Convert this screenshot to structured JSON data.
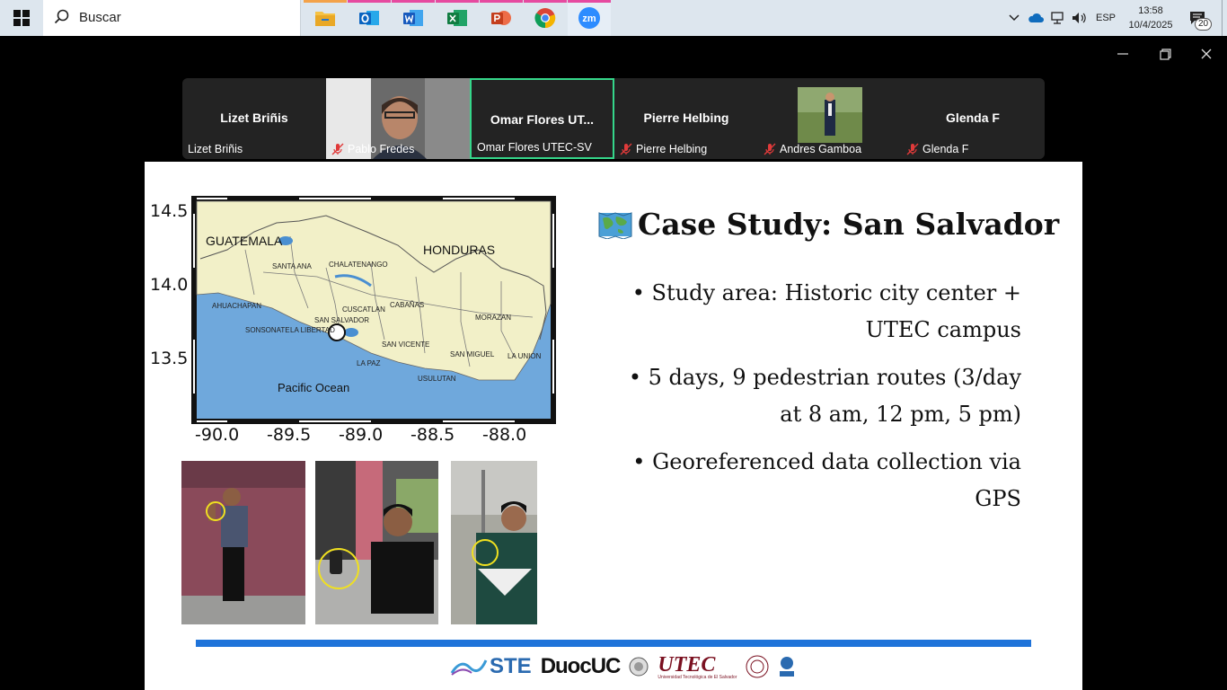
{
  "taskbar": {
    "search_placeholder": "Buscar",
    "apps": [
      {
        "name": "file-explorer",
        "bar": "#f3a24a"
      },
      {
        "name": "outlook",
        "bar": "#e64aa0"
      },
      {
        "name": "word",
        "bar": "#e64aa0"
      },
      {
        "name": "excel",
        "bar": "#e64aa0"
      },
      {
        "name": "powerpoint",
        "bar": "#e64aa0"
      },
      {
        "name": "chrome",
        "bar": "#e64aa0"
      },
      {
        "name": "zoom",
        "bar": "#e64aa0"
      }
    ],
    "language": "ESP",
    "time": "13:58",
    "date": "10/4/2025",
    "notifications": "20"
  },
  "participants": [
    {
      "center_name": "Lizet Briñis",
      "label": "Lizet Briñis",
      "muted": false,
      "video": false
    },
    {
      "center_name": "",
      "label": "Pablo Fredes",
      "muted": true,
      "video": true
    },
    {
      "center_name": "Omar Flores UT...",
      "label": "Omar Flores UTEC-SV",
      "muted": false,
      "video": false,
      "active": true
    },
    {
      "center_name": "Pierre Helbing",
      "label": "Pierre Helbing",
      "muted": true,
      "video": false
    },
    {
      "center_name": "",
      "label": "Andres Gamboa",
      "muted": true,
      "video": true
    },
    {
      "center_name": "Glenda F",
      "label": "Glenda F",
      "muted": true,
      "video": false
    }
  ],
  "slide": {
    "title": "Case Study: San Salvador",
    "bullets": [
      "Study area: Historic city center + UTEC campus",
      "5 days, 9 pedestrian routes (3/day at 8 am, 12 pm, 5 pm)",
      "Georeferenced data collection via GPS"
    ],
    "map": {
      "y_ticks": [
        "14.5",
        "14.0",
        "13.5"
      ],
      "x_ticks": [
        "-90.0",
        "-89.5",
        "-89.0",
        "-88.5",
        "-88.0"
      ],
      "countries": [
        "GUATEMALA",
        "HONDURAS"
      ],
      "ocean": "Pacific Ocean",
      "departments": [
        "SANTA ANA",
        "CHALATENANGO",
        "AHUACHAPAN",
        "CUSCATLAN",
        "CABAÑAS",
        "SONSONATE",
        "SAN SALVADOR",
        "LA LIBERTAD",
        "MORAZAN",
        "SAN VICENTE",
        "LA PAZ",
        "SAN MIGUEL",
        "LA UNION",
        "USULUTAN"
      ]
    },
    "logos": {
      "ste": "STE",
      "duoc": "DuocUC",
      "utec": "UTEC",
      "utec_sub": "Universidad Tecnológica de El Salvador"
    },
    "colors": {
      "land": "#f2f0c8",
      "sea": "#6fa8dc",
      "rule": "#1f73d9",
      "lake": "#4a8fd1"
    }
  }
}
